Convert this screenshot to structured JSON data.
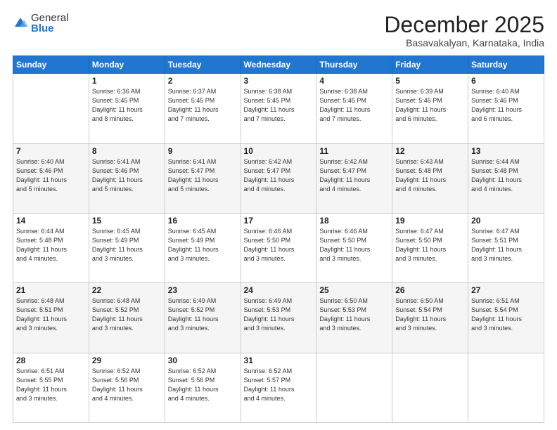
{
  "header": {
    "logo_general": "General",
    "logo_blue": "Blue",
    "month_title": "December 2025",
    "subtitle": "Basavakalyan, Karnataka, India"
  },
  "weekdays": [
    "Sunday",
    "Monday",
    "Tuesday",
    "Wednesday",
    "Thursday",
    "Friday",
    "Saturday"
  ],
  "weeks": [
    [
      {
        "day": "",
        "info": ""
      },
      {
        "day": "1",
        "info": "Sunrise: 6:36 AM\nSunset: 5:45 PM\nDaylight: 11 hours\nand 8 minutes."
      },
      {
        "day": "2",
        "info": "Sunrise: 6:37 AM\nSunset: 5:45 PM\nDaylight: 11 hours\nand 7 minutes."
      },
      {
        "day": "3",
        "info": "Sunrise: 6:38 AM\nSunset: 5:45 PM\nDaylight: 11 hours\nand 7 minutes."
      },
      {
        "day": "4",
        "info": "Sunrise: 6:38 AM\nSunset: 5:45 PM\nDaylight: 11 hours\nand 7 minutes."
      },
      {
        "day": "5",
        "info": "Sunrise: 6:39 AM\nSunset: 5:46 PM\nDaylight: 11 hours\nand 6 minutes."
      },
      {
        "day": "6",
        "info": "Sunrise: 6:40 AM\nSunset: 5:46 PM\nDaylight: 11 hours\nand 6 minutes."
      }
    ],
    [
      {
        "day": "7",
        "info": "Sunrise: 6:40 AM\nSunset: 5:46 PM\nDaylight: 11 hours\nand 5 minutes."
      },
      {
        "day": "8",
        "info": "Sunrise: 6:41 AM\nSunset: 5:46 PM\nDaylight: 11 hours\nand 5 minutes."
      },
      {
        "day": "9",
        "info": "Sunrise: 6:41 AM\nSunset: 5:47 PM\nDaylight: 11 hours\nand 5 minutes."
      },
      {
        "day": "10",
        "info": "Sunrise: 6:42 AM\nSunset: 5:47 PM\nDaylight: 11 hours\nand 4 minutes."
      },
      {
        "day": "11",
        "info": "Sunrise: 6:42 AM\nSunset: 5:47 PM\nDaylight: 11 hours\nand 4 minutes."
      },
      {
        "day": "12",
        "info": "Sunrise: 6:43 AM\nSunset: 5:48 PM\nDaylight: 11 hours\nand 4 minutes."
      },
      {
        "day": "13",
        "info": "Sunrise: 6:44 AM\nSunset: 5:48 PM\nDaylight: 11 hours\nand 4 minutes."
      }
    ],
    [
      {
        "day": "14",
        "info": "Sunrise: 6:44 AM\nSunset: 5:48 PM\nDaylight: 11 hours\nand 4 minutes."
      },
      {
        "day": "15",
        "info": "Sunrise: 6:45 AM\nSunset: 5:49 PM\nDaylight: 11 hours\nand 3 minutes."
      },
      {
        "day": "16",
        "info": "Sunrise: 6:45 AM\nSunset: 5:49 PM\nDaylight: 11 hours\nand 3 minutes."
      },
      {
        "day": "17",
        "info": "Sunrise: 6:46 AM\nSunset: 5:50 PM\nDaylight: 11 hours\nand 3 minutes."
      },
      {
        "day": "18",
        "info": "Sunrise: 6:46 AM\nSunset: 5:50 PM\nDaylight: 11 hours\nand 3 minutes."
      },
      {
        "day": "19",
        "info": "Sunrise: 6:47 AM\nSunset: 5:50 PM\nDaylight: 11 hours\nand 3 minutes."
      },
      {
        "day": "20",
        "info": "Sunrise: 6:47 AM\nSunset: 5:51 PM\nDaylight: 11 hours\nand 3 minutes."
      }
    ],
    [
      {
        "day": "21",
        "info": "Sunrise: 6:48 AM\nSunset: 5:51 PM\nDaylight: 11 hours\nand 3 minutes."
      },
      {
        "day": "22",
        "info": "Sunrise: 6:48 AM\nSunset: 5:52 PM\nDaylight: 11 hours\nand 3 minutes."
      },
      {
        "day": "23",
        "info": "Sunrise: 6:49 AM\nSunset: 5:52 PM\nDaylight: 11 hours\nand 3 minutes."
      },
      {
        "day": "24",
        "info": "Sunrise: 6:49 AM\nSunset: 5:53 PM\nDaylight: 11 hours\nand 3 minutes."
      },
      {
        "day": "25",
        "info": "Sunrise: 6:50 AM\nSunset: 5:53 PM\nDaylight: 11 hours\nand 3 minutes."
      },
      {
        "day": "26",
        "info": "Sunrise: 6:50 AM\nSunset: 5:54 PM\nDaylight: 11 hours\nand 3 minutes."
      },
      {
        "day": "27",
        "info": "Sunrise: 6:51 AM\nSunset: 5:54 PM\nDaylight: 11 hours\nand 3 minutes."
      }
    ],
    [
      {
        "day": "28",
        "info": "Sunrise: 6:51 AM\nSunset: 5:55 PM\nDaylight: 11 hours\nand 3 minutes."
      },
      {
        "day": "29",
        "info": "Sunrise: 6:52 AM\nSunset: 5:56 PM\nDaylight: 11 hours\nand 4 minutes."
      },
      {
        "day": "30",
        "info": "Sunrise: 6:52 AM\nSunset: 5:56 PM\nDaylight: 11 hours\nand 4 minutes."
      },
      {
        "day": "31",
        "info": "Sunrise: 6:52 AM\nSunset: 5:57 PM\nDaylight: 11 hours\nand 4 minutes."
      },
      {
        "day": "",
        "info": ""
      },
      {
        "day": "",
        "info": ""
      },
      {
        "day": "",
        "info": ""
      }
    ]
  ]
}
